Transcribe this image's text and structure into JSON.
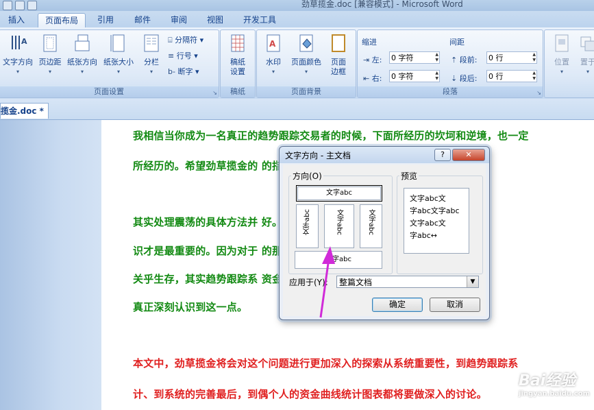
{
  "window": {
    "title": "劲草揽金.doc [兼容模式] - Microsoft Word"
  },
  "ribbon_tabs": [
    {
      "label": "插入"
    },
    {
      "label": "页面布局",
      "active": true
    },
    {
      "label": "引用"
    },
    {
      "label": "邮件"
    },
    {
      "label": "审阅"
    },
    {
      "label": "视图"
    },
    {
      "label": "开发工具"
    }
  ],
  "page_setup": {
    "group_label": "页面设置",
    "text_direction": "文字方向",
    "margins": "页边距",
    "orientation": "纸张方向",
    "size": "纸张大小",
    "columns": "分栏",
    "breaks": "分隔符",
    "line_numbers": "行号",
    "hyphenation": "断字"
  },
  "draft_group": {
    "group_label": "稿纸",
    "draft_setup_l1": "稿纸",
    "draft_setup_l2": "设置"
  },
  "page_background": {
    "group_label": "页面背景",
    "watermark": "水印",
    "page_color": "页面颜色",
    "borders_l1": "页面",
    "borders_l2": "边框"
  },
  "paragraph": {
    "group_label": "段落",
    "indent_label": "缩进",
    "indent_left_label": "左:",
    "indent_left_value": "0 字符",
    "indent_right_label": "右:",
    "indent_right_value": "0 字符",
    "spacing_label": "间距",
    "spacing_before_label": "段前:",
    "spacing_before_value": "0 行",
    "spacing_after_label": "段后:",
    "spacing_after_value": "0 行"
  },
  "arrange": {
    "position": "位置",
    "front": "置于"
  },
  "doc_tab": {
    "label": "揽金.doc *"
  },
  "document": {
    "lines": [
      {
        "text": "我相信当你成为一名真正的趋势跟踪交易者的时候，下面所经历的坎坷和逆境，也一定",
        "color": "#138a13"
      },
      {
        "text": "所经历的。希望劲草揽金的                                        的指引。",
        "color": "#138a13"
      },
      {
        "text": "其实处理震荡的具体方法并                                        好。总之，处理震",
        "color": "#138a13"
      },
      {
        "text": "识才是最重要的。因为对于                                        的那一块，而最短",
        "color": "#138a13"
      },
      {
        "text": "关乎生存，其实趋势跟踪系                                        资金管理，只是很",
        "color": "#138a13"
      },
      {
        "text": "真正深刻认识到这一点。",
        "color": "#138a13"
      },
      {
        "text": "本文中，劲草揽金将会对这个问题进行更加深入的探索从系统重要性，到趋势跟踪系",
        "color": "#e02020"
      },
      {
        "text": "计、到系统的完善最后，到偶个人的资金曲线统计图表都将要做深入的讨论。",
        "color": "#e02020"
      }
    ]
  },
  "dialog": {
    "title": "文字方向 - 主文档",
    "help_button": "?",
    "close_button": "✕",
    "orientation_label": "方向(O)",
    "options": [
      "文字abc",
      "文字abc",
      "文字abc",
      "文字abc",
      "文字abc"
    ],
    "preview_label": "预览",
    "preview_lines": [
      "文字abc文",
      "字abc文字abc",
      "文字abc文",
      "字abc↔"
    ],
    "apply_to_label": "应用于(Y):",
    "apply_to_value": "整篇文档",
    "ok": "确定",
    "cancel": "取消"
  },
  "watermark": {
    "text": "Bai经验",
    "sub": "jingyan.baidu.com"
  }
}
